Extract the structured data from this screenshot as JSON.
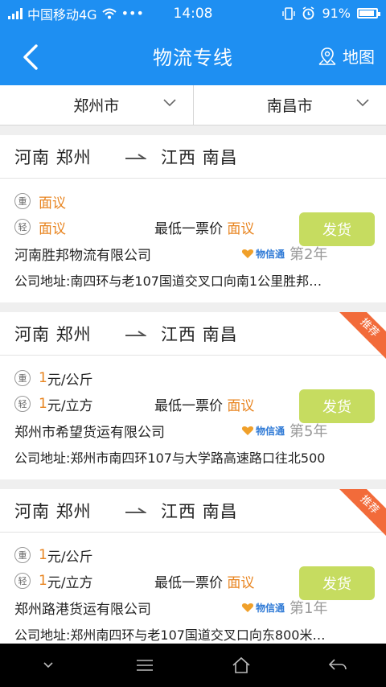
{
  "status_bar": {
    "carrier": "中国移动4G",
    "more": "•••",
    "time": "14:08",
    "battery": "91%",
    "battery_level": 0.91
  },
  "header": {
    "title": "物流专线",
    "map_label": "地图",
    "back_icon": "chevron-left-icon",
    "map_icon": "map-pin-icon"
  },
  "selector": {
    "from_city": "郑州市",
    "to_city": "南昌市"
  },
  "colors": {
    "primary": "#1e8ff2",
    "accent_orange": "#e8841f",
    "ship_button": "#c6dc60",
    "ribbon": "#f26b3a"
  },
  "cards": [
    {
      "from": "河南  郑州",
      "to": "江西  南昌",
      "ribbon": "",
      "heavy_tag": "重",
      "heavy_price": "面议",
      "light_tag": "轻",
      "light_price": "面议",
      "lowest_label": "最低一票价",
      "lowest_value": "面议",
      "ship_label": "发货",
      "company": "河南胜邦物流有限公司",
      "badge": "物信通",
      "years": "第2年",
      "address": "公司地址:南四环与老107国道交叉口向南1公里胜邦…"
    },
    {
      "from": "河南  郑州",
      "to": "江西  南昌",
      "ribbon": "推荐",
      "heavy_tag": "重",
      "heavy_price": "1",
      "heavy_unit": "元/公斤",
      "light_tag": "轻",
      "light_price": "1",
      "light_unit": "元/立方",
      "lowest_label": "最低一票价",
      "lowest_value": "面议",
      "ship_label": "发货",
      "company": "郑州市希望货运有限公司",
      "badge": "物信通",
      "years": "第5年",
      "address": "公司地址:郑州市南四环107与大学路高速路口往北500"
    },
    {
      "from": "河南  郑州",
      "to": "江西  南昌",
      "ribbon": "推荐",
      "heavy_tag": "重",
      "heavy_price": "1",
      "heavy_unit": "元/公斤",
      "light_tag": "轻",
      "light_price": "1",
      "light_unit": "元/立方",
      "lowest_label": "最低一票价",
      "lowest_value": "面议",
      "ship_label": "发货",
      "company": "郑州路港货运有限公司",
      "badge": "物信通",
      "years": "第1年",
      "address": "公司地址:郑州南四环与老107国道交叉口向东800米…"
    }
  ],
  "nav_bar": {
    "items": [
      "chevron-down-icon",
      "menu-icon",
      "home-icon",
      "back-arrow-icon"
    ]
  }
}
